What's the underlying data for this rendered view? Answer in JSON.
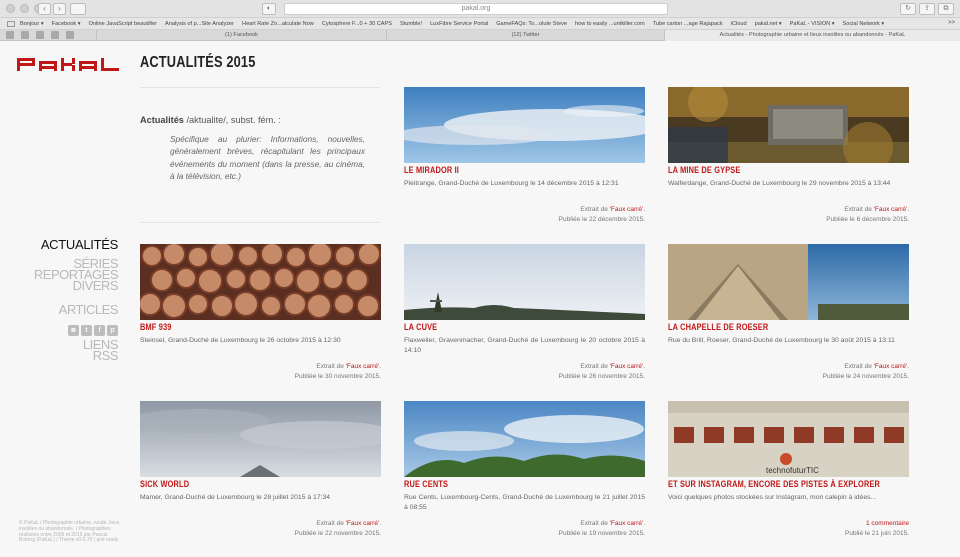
{
  "browser": {
    "url": "pakal.org",
    "bookmarks": [
      "Bonjour ▾",
      "Facebook ▾",
      "Online JavaScript beautifier",
      "Analysis of p...Site Analyzer",
      "Heart Rate Zo...alculate Now",
      "Cytosphere F...0 + 30 CAPS",
      "Stumble!",
      "LuxFibre Service Portal",
      "GameFAQs: To...olute Steve",
      "how to easily ...untkiller.com",
      "Tube carton ...age Rajapack",
      "iCloud",
      "pakal.net ▾",
      "PaKaL - VISION ▾",
      "Social Network ▾"
    ],
    "bookmarks_more": ">>",
    "tabs": [
      "(1) Facebook",
      "(12) Twitter",
      "Actualités - Photographie urbaine et lieux insolites ou abandonnés - PaKaL"
    ]
  },
  "site": {
    "logo_text": "PaKaL",
    "nav_active": "ACTUALITÉS",
    "nav_group": [
      "SÉRIES",
      "REPORTAGES",
      "DIVERS"
    ],
    "nav_articles": "ARTICLES",
    "social": [
      "instagram-icon",
      "twitter-icon",
      "facebook-icon",
      "pinterest-icon"
    ],
    "nav_liens": "LIENS",
    "nav_rss": "RSS",
    "copyright": "© PaKaL / Photographie urbaine, rurale, lieux insolites ou abandonnés. | Photographies réalisées entre 2005 et 2015 par Pascal Boberg (PaKaL) / Theme v0.6.70 | qnē ready"
  },
  "intro": {
    "title": "ACTUALITÉS 2015",
    "term": "Actualités",
    "pron": " /aktualite/, subst. fém. :",
    "definition": "Spécifique au plurier: Informations, nouvelles, généralement brèves, récapitulant les principaux événements du moment (dans la presse, au cinéma, à la télévision, etc.)"
  },
  "labels": {
    "extrait": "Extrait de ",
    "series_name": "'Faux carré'",
    "dot": "."
  },
  "cards": [
    {
      "title": "LE MIRADOR II",
      "meta": "Pleitrange, Grand-Duché de Luxembourg le 14 décembre 2015 à 12:31",
      "foot1": "",
      "foot2": "Publiée le 22 décembre 2015."
    },
    {
      "title": "LA MINE DE GYPSE",
      "meta": "Walferdange, Grand-Duché de Luxembourg le 29 novembre 2015 à 13:44",
      "foot1": "",
      "foot2": "Publiée le 6 décembre 2015."
    },
    {
      "title": "BMF 939",
      "meta": "Steinsel, Grand-Duché de Luxembourg le 26 octobre 2015 à 12:30",
      "foot1": "",
      "foot2": "Publiée le 30 novembre 2015."
    },
    {
      "title": "LA CUVE",
      "meta": "Flaxweiler, Gravenmacher, Grand-Duché de Luxembourg le 20 octobre 2015 à 14:10",
      "foot1": "",
      "foot2": "Publiée le 26 novembre 2015."
    },
    {
      "title": "LA CHAPELLE DE ROESER",
      "meta": "Rue du Brill, Roeser, Grand-Duché de Luxembourg le 30 août 2015 à 13:11",
      "foot1": "",
      "foot2": "Publiée le 24 novembre 2015."
    },
    {
      "title": "SICK WORLD",
      "meta": "Mamer, Grand-Duché de Luxembourg le 28 juillet 2015 à 17:34",
      "foot1": "",
      "foot2": "Publiée le 22 novembre 2015."
    },
    {
      "title": "RUE CENTS",
      "meta": "Rue Cents, Luxembourg-Cents, Grand-Duché de Luxembourg le 21 juillet 2015 à 08:55",
      "foot1": "",
      "foot2": "Publiée le 19 novembre 2015."
    },
    {
      "title": "ET SUR INSTAGRAM, ENCORE DES PISTES À EXPLORER",
      "meta": "Voici quelques photos stockées sur Instagram, mon calepin à idées...",
      "foot1": "1 commentaire",
      "foot2": "Publié le 21 juin 2015."
    }
  ],
  "colors": {
    "accent": "#c01818",
    "background": "#f7f7f7"
  }
}
